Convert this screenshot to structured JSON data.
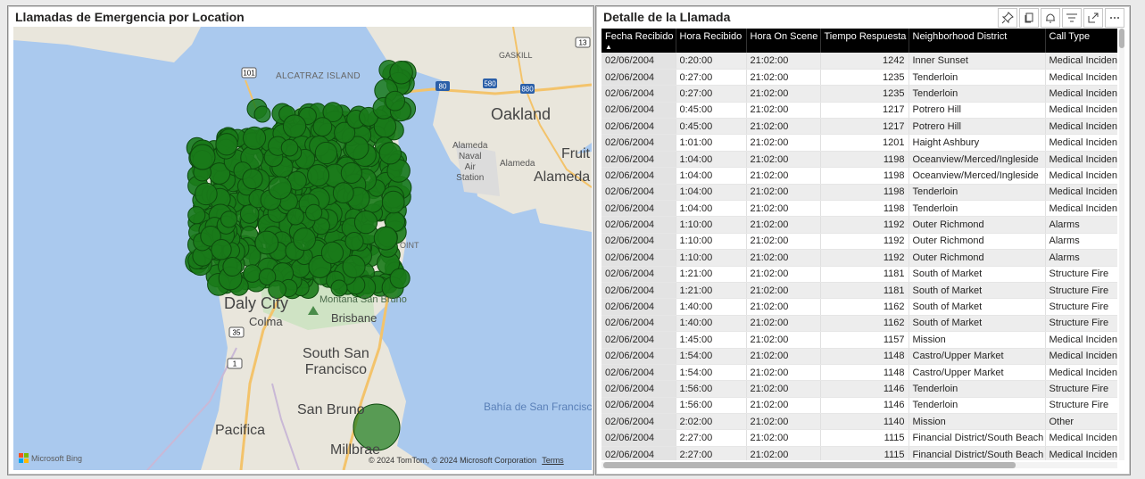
{
  "map_visual": {
    "title": "Llamadas de Emergencia por Location",
    "attribution": "© 2024 TomTom, © 2024 Microsoft Corporation",
    "terms_link": "Terms",
    "provider": "Microsoft Bing",
    "marker_color": "#1a7a1a",
    "places": [
      {
        "id": "alcatraz",
        "text": "ALCATRAZ ISLAND"
      },
      {
        "id": "gaskill",
        "text": "GASKILL"
      },
      {
        "id": "oakland",
        "text": "Oakland"
      },
      {
        "id": "alameda-naval",
        "text": "Alameda\nNaval\nAir\nStation"
      },
      {
        "id": "alameda-small",
        "text": "Alameda"
      },
      {
        "id": "alameda",
        "text": "Alameda"
      },
      {
        "id": "fruitvale",
        "text": "Fruit"
      },
      {
        "id": "point",
        "text": "OINT"
      },
      {
        "id": "montana",
        "text": "Montana San Bruno"
      },
      {
        "id": "daly",
        "text": "Daly City"
      },
      {
        "id": "colma",
        "text": "Colma"
      },
      {
        "id": "brisbane",
        "text": "Brisbane"
      },
      {
        "id": "ssf",
        "text": "South San\nFrancisco"
      },
      {
        "id": "bahia",
        "text": "Bahía de San Francisco"
      },
      {
        "id": "sanbruno",
        "text": "San Bruno"
      },
      {
        "id": "pacifica",
        "text": "Pacifica"
      },
      {
        "id": "millbrae",
        "text": "Millbrae"
      }
    ],
    "shields": [
      "101",
      "80",
      "580",
      "880",
      "35",
      "1",
      "13"
    ]
  },
  "table_visual": {
    "title": "Detalle de la Llamada",
    "toolbar": [
      "pin-icon",
      "copy-icon",
      "bell-icon",
      "filter-icon",
      "focus-mode-icon",
      "more-options-icon"
    ],
    "columns": [
      "Fecha Recibido",
      "Hora Recibido",
      "Hora On Scene",
      "Tiempo Respuesta",
      "Neighborhood District",
      "Call Type"
    ],
    "rows": [
      [
        "02/06/2004",
        "0:20:00",
        "21:02:00",
        "1242",
        "Inner Sunset",
        "Medical Incident"
      ],
      [
        "02/06/2004",
        "0:27:00",
        "21:02:00",
        "1235",
        "Tenderloin",
        "Medical Incident"
      ],
      [
        "02/06/2004",
        "0:27:00",
        "21:02:00",
        "1235",
        "Tenderloin",
        "Medical Incident"
      ],
      [
        "02/06/2004",
        "0:45:00",
        "21:02:00",
        "1217",
        "Potrero Hill",
        "Medical Incident"
      ],
      [
        "02/06/2004",
        "0:45:00",
        "21:02:00",
        "1217",
        "Potrero Hill",
        "Medical Incident"
      ],
      [
        "02/06/2004",
        "1:01:00",
        "21:02:00",
        "1201",
        "Haight Ashbury",
        "Medical Incident"
      ],
      [
        "02/06/2004",
        "1:04:00",
        "21:02:00",
        "1198",
        "Oceanview/Merced/Ingleside",
        "Medical Incident"
      ],
      [
        "02/06/2004",
        "1:04:00",
        "21:02:00",
        "1198",
        "Oceanview/Merced/Ingleside",
        "Medical Incident"
      ],
      [
        "02/06/2004",
        "1:04:00",
        "21:02:00",
        "1198",
        "Tenderloin",
        "Medical Incident"
      ],
      [
        "02/06/2004",
        "1:04:00",
        "21:02:00",
        "1198",
        "Tenderloin",
        "Medical Incident"
      ],
      [
        "02/06/2004",
        "1:10:00",
        "21:02:00",
        "1192",
        "Outer Richmond",
        "Alarms"
      ],
      [
        "02/06/2004",
        "1:10:00",
        "21:02:00",
        "1192",
        "Outer Richmond",
        "Alarms"
      ],
      [
        "02/06/2004",
        "1:10:00",
        "21:02:00",
        "1192",
        "Outer Richmond",
        "Alarms"
      ],
      [
        "02/06/2004",
        "1:21:00",
        "21:02:00",
        "1181",
        "South of Market",
        "Structure Fire"
      ],
      [
        "02/06/2004",
        "1:21:00",
        "21:02:00",
        "1181",
        "South of Market",
        "Structure Fire"
      ],
      [
        "02/06/2004",
        "1:40:00",
        "21:02:00",
        "1162",
        "South of Market",
        "Structure Fire"
      ],
      [
        "02/06/2004",
        "1:40:00",
        "21:02:00",
        "1162",
        "South of Market",
        "Structure Fire"
      ],
      [
        "02/06/2004",
        "1:45:00",
        "21:02:00",
        "1157",
        "Mission",
        "Medical Incident"
      ],
      [
        "02/06/2004",
        "1:54:00",
        "21:02:00",
        "1148",
        "Castro/Upper Market",
        "Medical Incident"
      ],
      [
        "02/06/2004",
        "1:54:00",
        "21:02:00",
        "1148",
        "Castro/Upper Market",
        "Medical Incident"
      ],
      [
        "02/06/2004",
        "1:56:00",
        "21:02:00",
        "1146",
        "Tenderloin",
        "Structure Fire"
      ],
      [
        "02/06/2004",
        "1:56:00",
        "21:02:00",
        "1146",
        "Tenderloin",
        "Structure Fire"
      ],
      [
        "02/06/2004",
        "2:02:00",
        "21:02:00",
        "1140",
        "Mission",
        "Other"
      ],
      [
        "02/06/2004",
        "2:27:00",
        "21:02:00",
        "1115",
        "Financial District/South Beach",
        "Medical Incident"
      ],
      [
        "02/06/2004",
        "2:27:00",
        "21:02:00",
        "1115",
        "Financial District/South Beach",
        "Medical Incident"
      ]
    ]
  }
}
